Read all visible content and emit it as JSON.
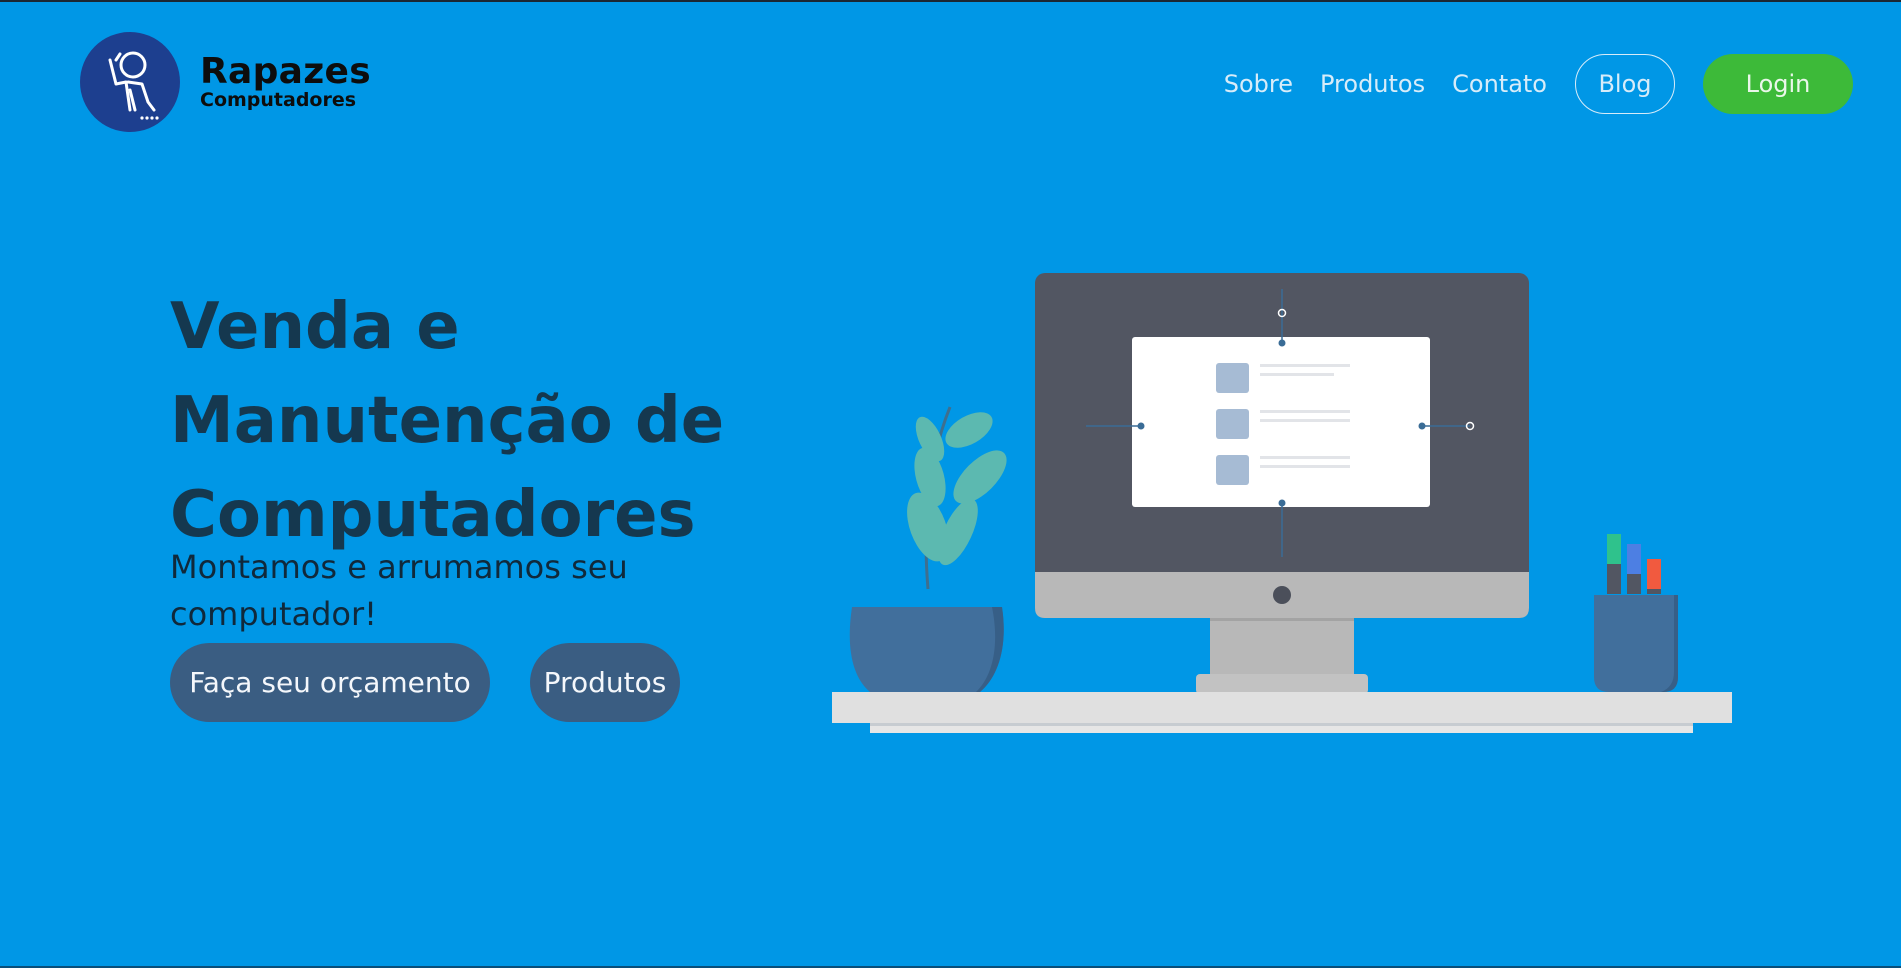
{
  "brand": {
    "title": "Rapazes",
    "subtitle": "Computadores",
    "logo_icon": "waving-person-icon"
  },
  "nav": {
    "links": [
      "Sobre",
      "Produtos",
      "Contato"
    ],
    "blog": "Blog",
    "login": "Login"
  },
  "hero": {
    "title_lines": [
      "Venda e",
      "Manutenção de",
      "Computadores"
    ],
    "subtitle": "Montamos e arrumamos seu computador!",
    "primary_cta": "Faça seu orçamento",
    "secondary_cta": "Produtos"
  },
  "colors": {
    "background": "#0097e6",
    "login_button": "#3dba39",
    "cta_button": "#3a5d82",
    "heading": "#15384f"
  },
  "illustration": {
    "icons": [
      "desktop-monitor-icon",
      "potted-plant-icon",
      "pen-holder-icon"
    ]
  }
}
